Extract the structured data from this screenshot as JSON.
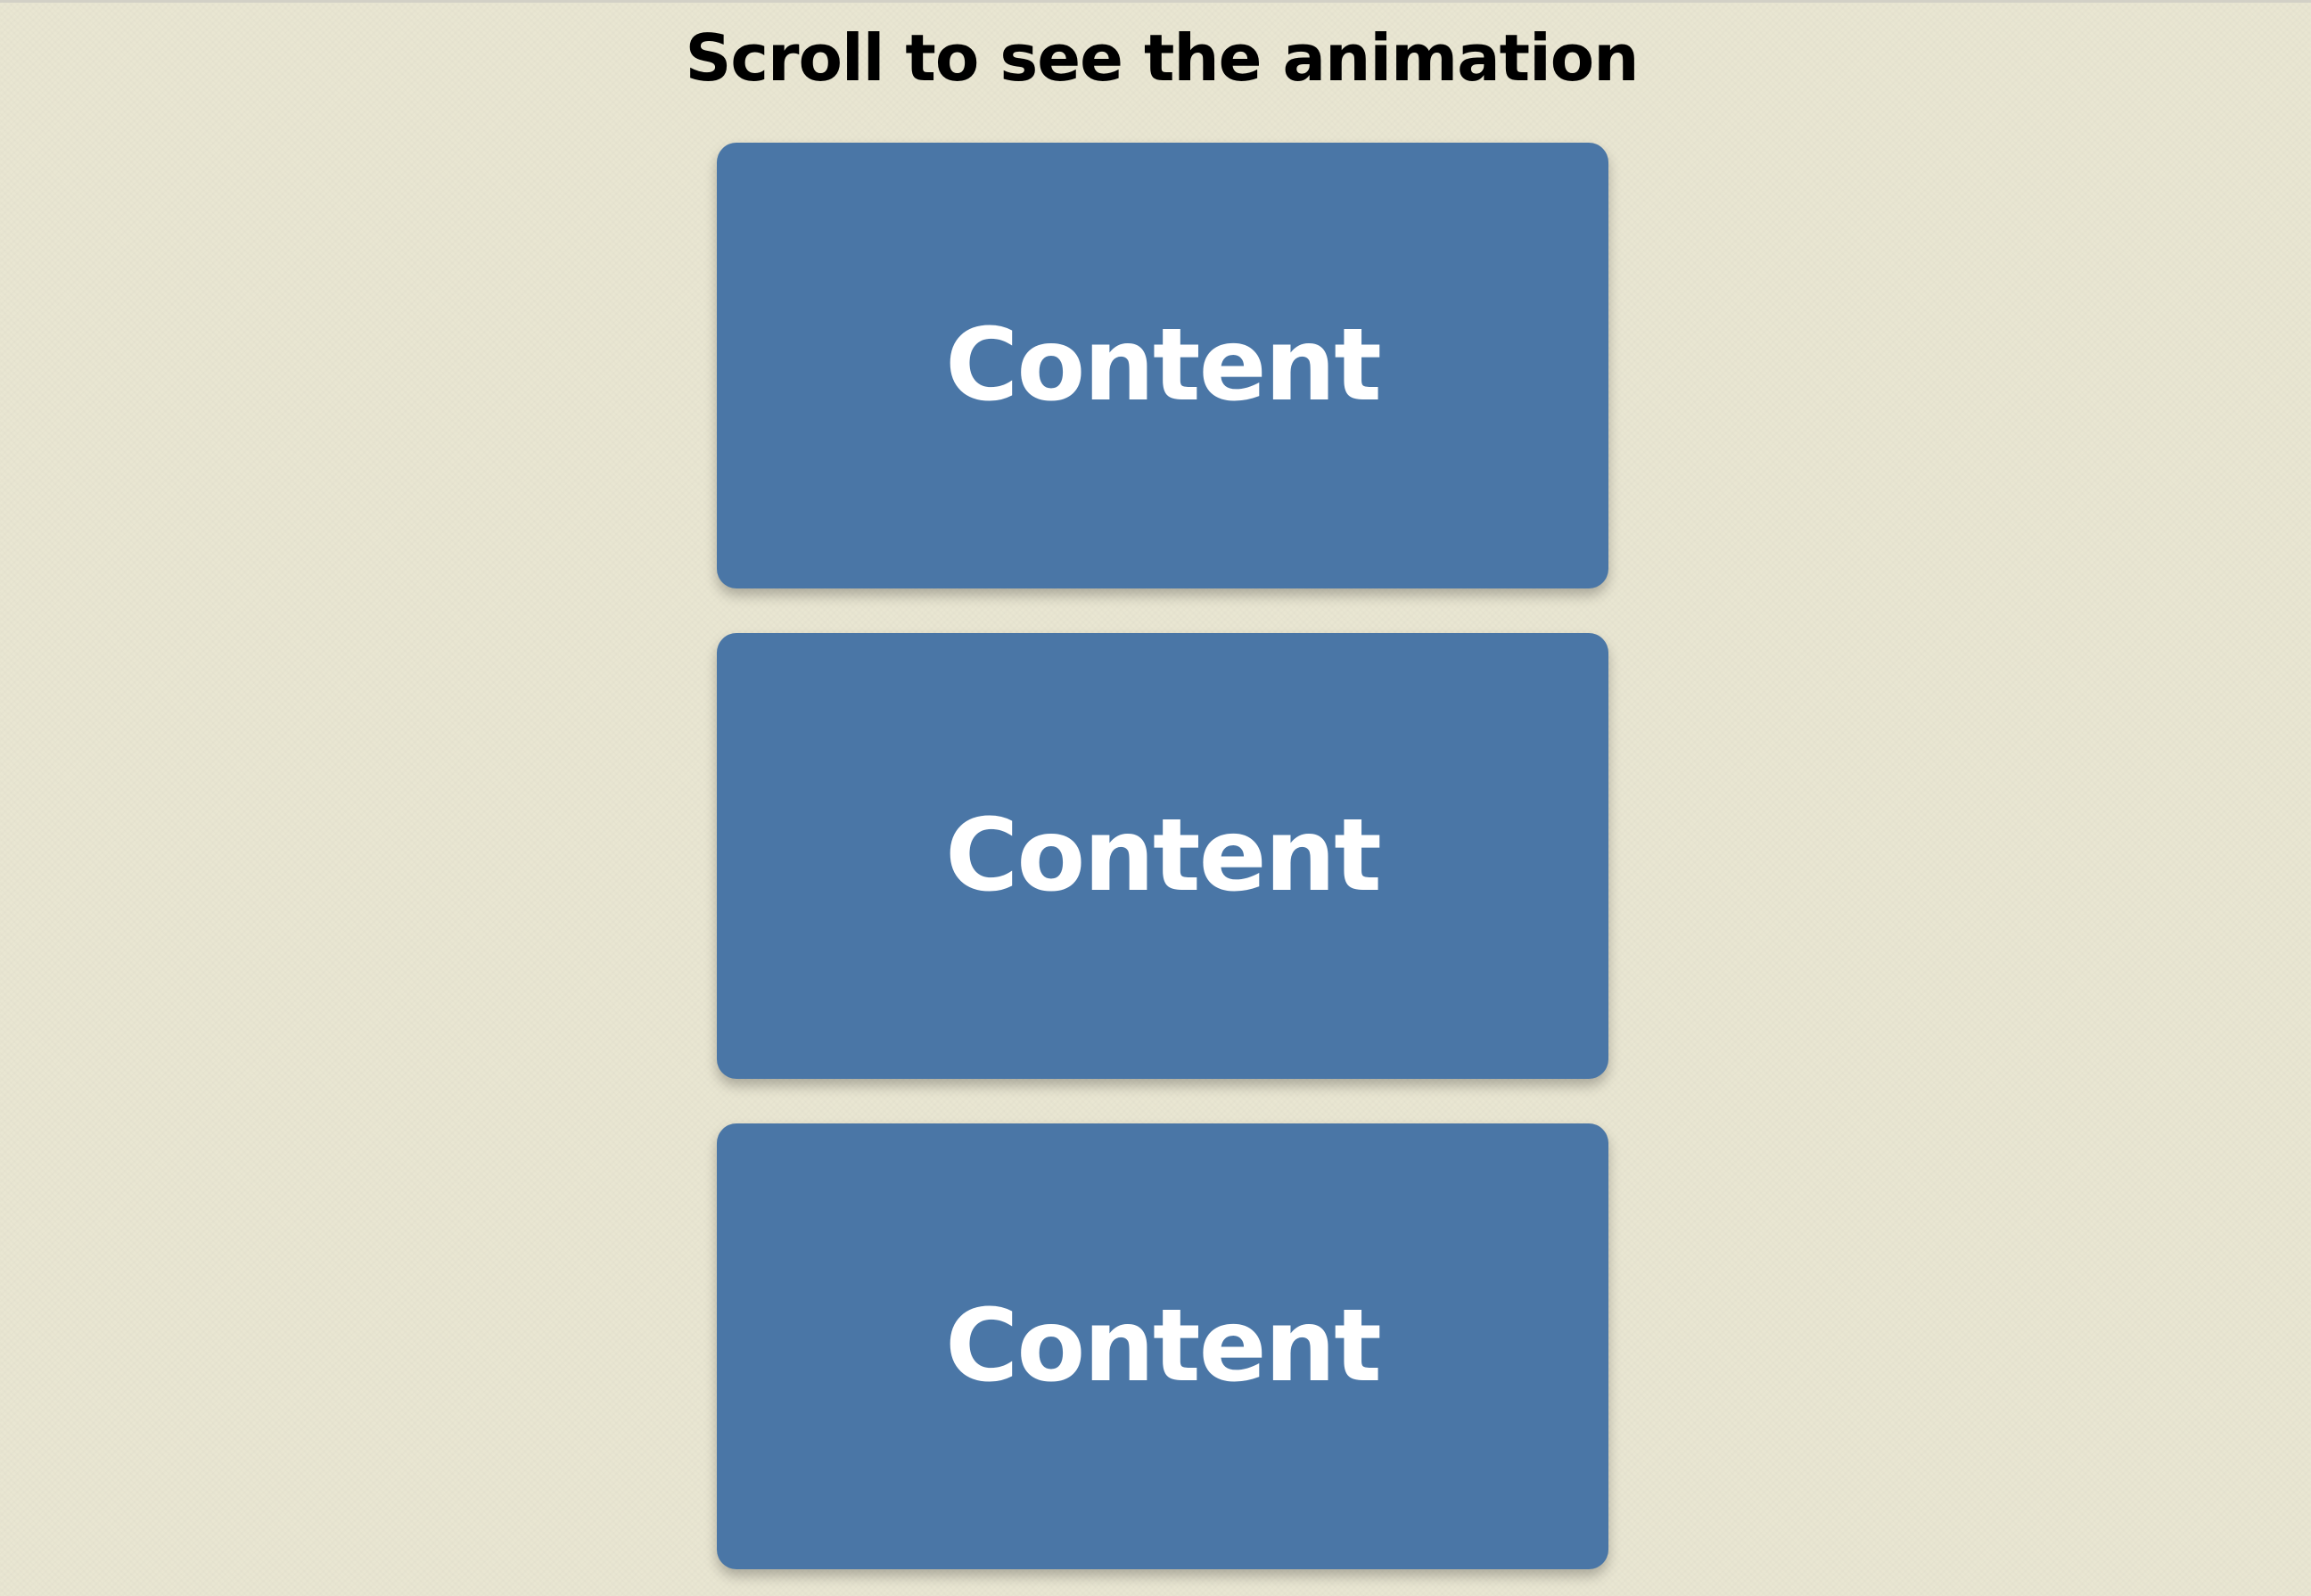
{
  "page": {
    "title": "Scroll to see the animation"
  },
  "cards": [
    {
      "label": "Content"
    },
    {
      "label": "Content"
    },
    {
      "label": "Content"
    }
  ],
  "colors": {
    "background": "#e9e6d2",
    "card": "#4a76a6",
    "card_text": "#ffffff",
    "title_text": "#000000"
  }
}
